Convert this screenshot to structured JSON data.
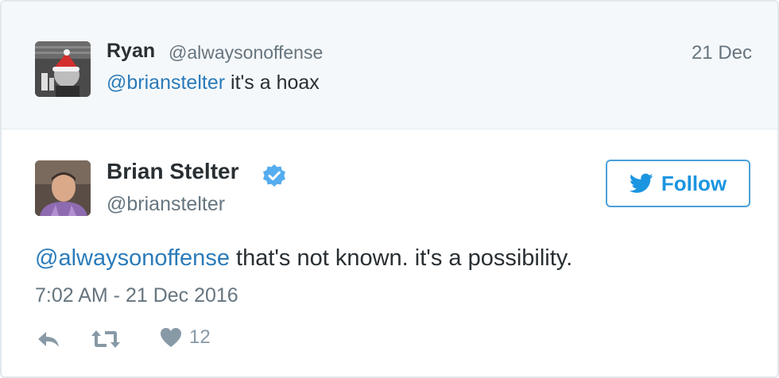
{
  "parent_tweet": {
    "display_name": "Ryan",
    "handle": "@alwaysonoffense",
    "date": "21 Dec",
    "mention": "@brianstelter",
    "text": " it's a hoax",
    "avatar_icon": "avatar-santa-hat-icon"
  },
  "tweet": {
    "display_name": "Brian Stelter",
    "verified": true,
    "handle": "@brianstelter",
    "follow_label": "Follow",
    "mention": "@alwaysonoffense",
    "text": " that's not known. it's a possibility.",
    "timestamp": "7:02 AM - 21 Dec 2016",
    "like_count": "12",
    "actions": [
      "reply-icon",
      "retweet-icon",
      "heart-icon"
    ],
    "avatar_icon": "avatar-photo-icon"
  },
  "colors": {
    "link": "#2b7bb9",
    "follow_blue": "#1b95e0",
    "verified_blue": "#55acee",
    "muted": "#66757f",
    "action_gray": "#8899a6"
  }
}
